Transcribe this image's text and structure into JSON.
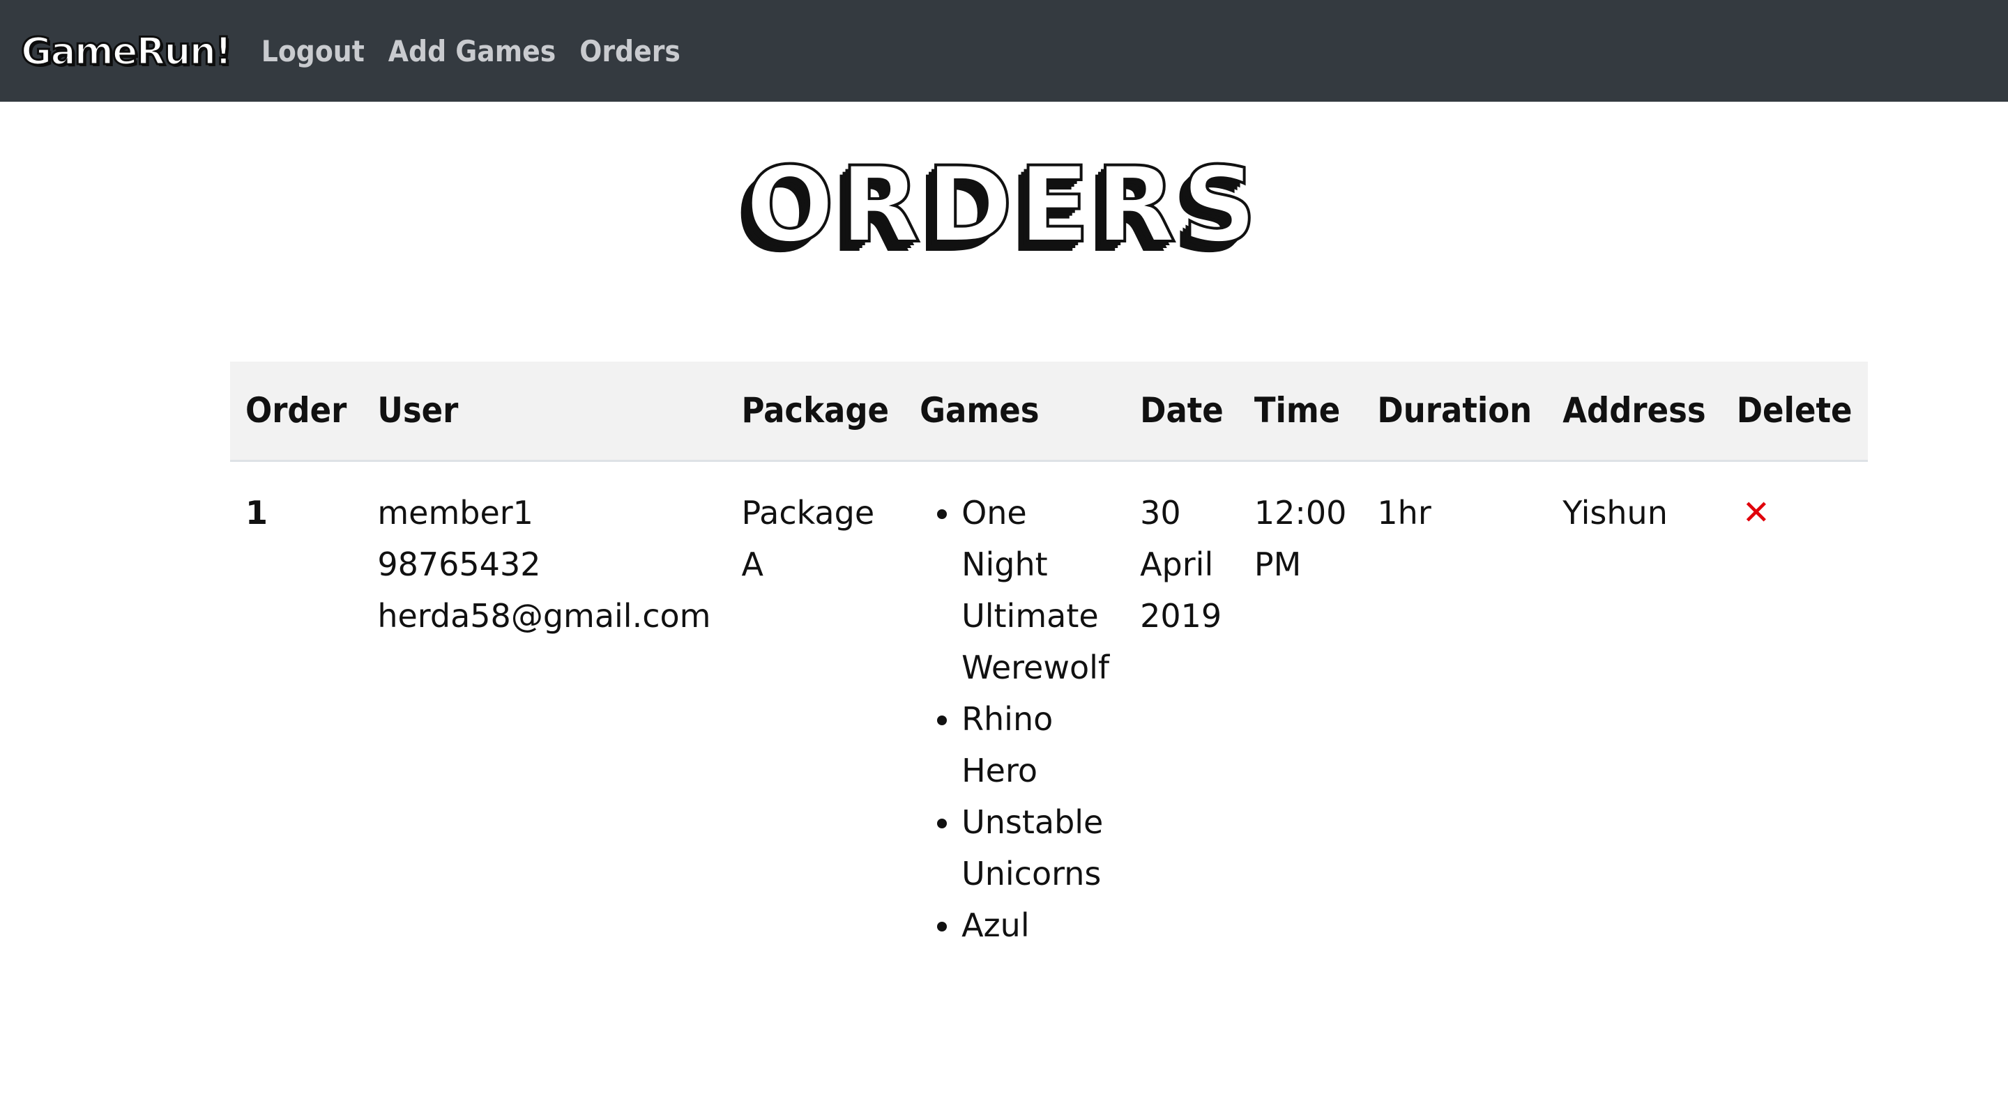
{
  "navbar": {
    "brand": "GameRun!",
    "links": [
      "Logout",
      "Add Games",
      "Orders"
    ]
  },
  "page": {
    "title": "ORDERS"
  },
  "table": {
    "headers": [
      "Order",
      "User",
      "Package",
      "Games",
      "Date",
      "Time",
      "Duration",
      "Address",
      "Delete"
    ],
    "rows": [
      {
        "order": "1",
        "user_name": "member1",
        "user_phone": "98765432",
        "user_email": "herda58@gmail.com",
        "package": "Package A",
        "games": [
          "One Night Ultimate Werewolf",
          "Rhino Hero",
          "Unstable Unicorns",
          "Azul"
        ],
        "date": "30 April 2019",
        "time": "12:00 PM",
        "duration": "1hr",
        "address": "Yishun",
        "delete_icon": "✕"
      }
    ]
  },
  "colors": {
    "navbar_bg": "#343a40",
    "header_row_bg": "#f2f2f2",
    "delete_icon": "#e0000b"
  },
  "icons": {
    "delete": "close-icon"
  }
}
